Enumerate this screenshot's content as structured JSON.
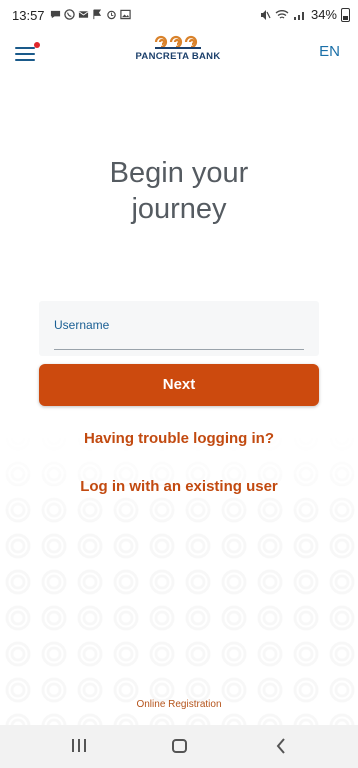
{
  "status_bar": {
    "time": "13:57",
    "battery": "34%",
    "network": "Vo))\nLTE1"
  },
  "header": {
    "logo_text": "PANCRETA BANK",
    "language": "EN",
    "brand_colors": {
      "navy": "#1b3f6b",
      "orange": "#d9822b"
    }
  },
  "main": {
    "heading_line1": "Begin your",
    "heading_line2": "journey",
    "username_label": "Username",
    "username_value": "",
    "next_label": "Next",
    "trouble_link": "Having trouble logging in?",
    "existing_user_link": "Log in with an existing user",
    "accent_color": "#cc4a0e"
  },
  "footer": {
    "online_registration": "Online Registration"
  }
}
